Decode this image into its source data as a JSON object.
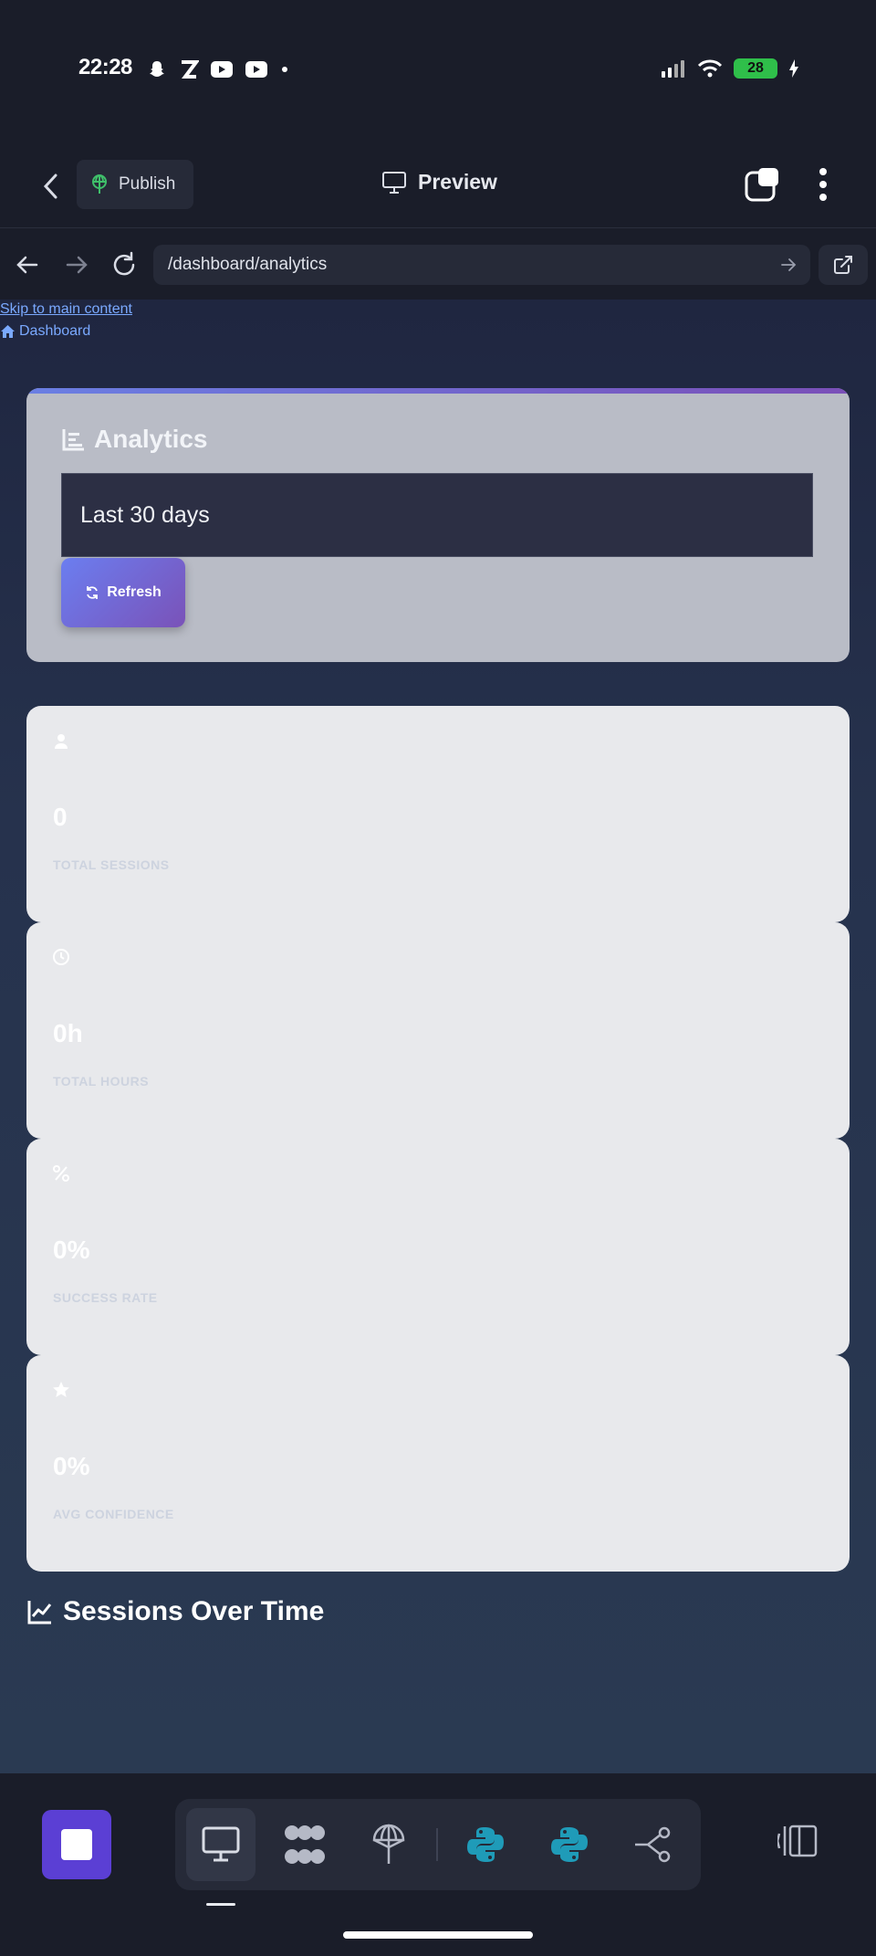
{
  "status_bar": {
    "time": "22:28",
    "battery": "28"
  },
  "header": {
    "publish_label": "Publish",
    "preview_label": "Preview"
  },
  "browser": {
    "url": "/dashboard/analytics"
  },
  "page": {
    "skip_link": "Skip to main content",
    "breadcrumb": "Dashboard",
    "analytics_title": "Analytics",
    "range_value": "Last 30 days",
    "refresh_label": "Refresh",
    "stats": [
      {
        "icon": "users-icon",
        "value": "0",
        "label": "TOTAL SESSIONS"
      },
      {
        "icon": "clock-icon",
        "value": "0h",
        "label": "TOTAL HOURS"
      },
      {
        "icon": "percent-icon",
        "value": "0%",
        "label": "SUCCESS RATE"
      },
      {
        "icon": "star-icon",
        "value": "0%",
        "label": "AVG CONFIDENCE"
      }
    ],
    "sessions_heading": "Sessions Over Time"
  },
  "colors": {
    "accent": "#5b3fd4",
    "link": "#7aa9ff",
    "button_gradient_start": "#6b7ef0",
    "button_gradient_end": "#7a52b8"
  }
}
